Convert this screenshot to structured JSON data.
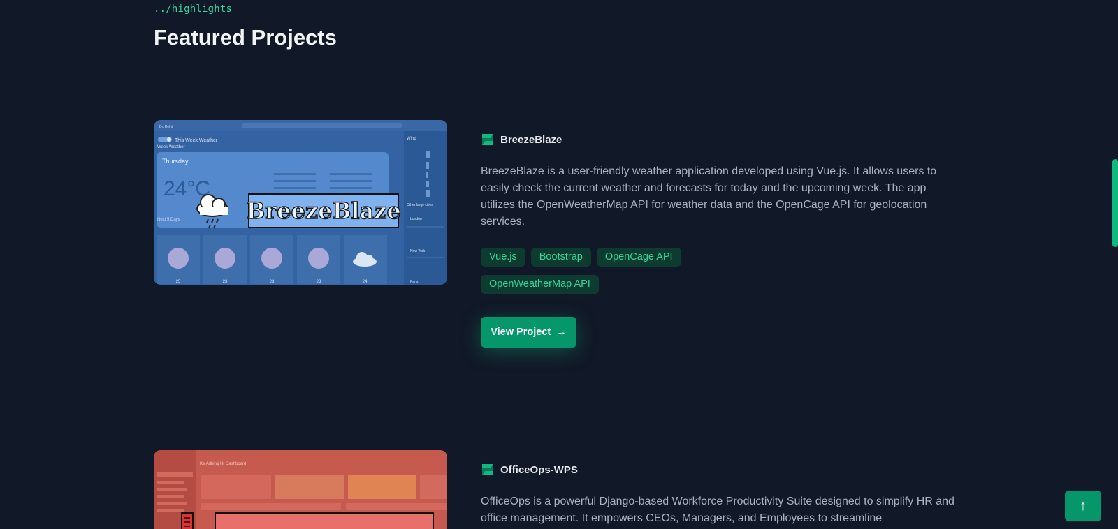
{
  "breadcrumb": "../highlights",
  "section_title": "Featured Projects",
  "colors": {
    "accent": "#10b981",
    "background": "#111827",
    "tag_bg": "#0d3b30"
  },
  "projects": [
    {
      "name": "BreezeBlaze",
      "icon": "brand-logo-icon",
      "description": "BreezeBlaze is a user-friendly weather application developed using Vue.js. It allows users to easily check the current weather and forecasts for today and the upcoming week. The app utilizes the OpenWeatherMap API for weather data and the OpenCage API for geolocation services.",
      "tags": [
        "Vue.js",
        "Bootstrap",
        "OpenCage API",
        "OpenWeatherMap API"
      ],
      "button": "View Project",
      "thumbnail": {
        "banner": "BreezeBlaze",
        "location": "Dr. Delhi",
        "toggle_label": "This Week Weather",
        "sub_label": "Week Weather",
        "day": "Thursday",
        "temperature": "24°C",
        "next_days_label": "Next 5 Days",
        "wind_label": "Wind",
        "other_cities_label": "Other large cities",
        "cities": [
          "London",
          "New York",
          "Paris"
        ],
        "forecast_temps": [
          "25",
          "23",
          "23",
          "23",
          "24"
        ]
      }
    },
    {
      "name": "OfficeOps-WPS",
      "icon": "brand-logo-icon",
      "description": "OfficeOps is a powerful Django-based Workforce Productivity Suite designed to simplify HR and office management. It empowers CEOs, Managers, and Employees to streamline",
      "thumbnail": {
        "header": "Ke Adhiraj Hr Dashboard"
      }
    }
  ],
  "scroll_top_label": "↑"
}
